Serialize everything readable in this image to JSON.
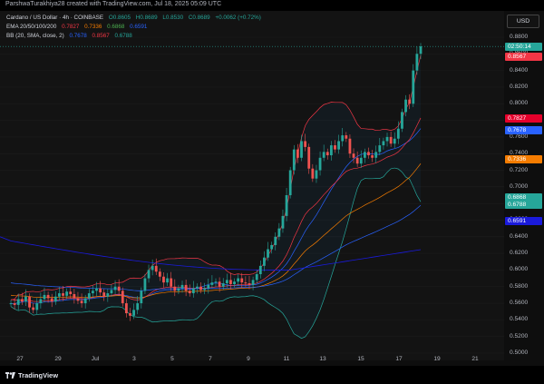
{
  "header": {
    "created_by": "ParshwaTurakhiya28 created with TradingView.com, Jul 18, 2025 05:09 UTC"
  },
  "legend": {
    "symbol_line": {
      "name": "Cardano / US Dollar · 4h · COINBASE",
      "o": "O0.8605",
      "h": "H0.8689",
      "l": "L0.8530",
      "c": "C0.8689",
      "change": "+0.0062 (+0.72%)"
    },
    "ema_line": {
      "name": "EMA 20/50/100/200",
      "v1": "0.7827",
      "v2": "0.7336",
      "v3": "0.6868",
      "v4": "0.6591"
    },
    "bb_line": {
      "name": "BB (20, SMA, close, 2)",
      "v1": "0.7678",
      "v2": "0.8567",
      "v3": "0.6788"
    }
  },
  "currency_button": "USD",
  "price_axis": {
    "ticks": [
      "0.8800",
      "0.8600",
      "0.8400",
      "0.8200",
      "0.8000",
      "0.7800",
      "0.7600",
      "0.7400",
      "0.7200",
      "0.7000",
      "0.6800",
      "0.6600",
      "0.6400",
      "0.6200",
      "0.6000",
      "0.5800",
      "0.5600",
      "0.5400",
      "0.5200",
      "0.5000"
    ],
    "tags": [
      {
        "label": "02:50:14",
        "price": 0.8689,
        "color": "#26a69a"
      },
      {
        "label": "0.8567",
        "price": 0.8567,
        "color": "#f23645"
      },
      {
        "label": "0.7827",
        "price": 0.7827,
        "color": "#e5002b"
      },
      {
        "label": "0.7678",
        "price": 0.7678,
        "color": "#2962ff"
      },
      {
        "label": "0.7336",
        "price": 0.7336,
        "color": "#f57c00"
      },
      {
        "label": "0.6868",
        "price": 0.6868,
        "color": "#26a69a"
      },
      {
        "label": "0.6788",
        "price": 0.6788,
        "color": "#26a69a"
      },
      {
        "label": "0.6591",
        "price": 0.6591,
        "color": "#1a1adb"
      }
    ]
  },
  "time_axis": {
    "ticks": [
      "27",
      "29",
      "Jul",
      "3",
      "5",
      "7",
      "9",
      "11",
      "13",
      "15",
      "17",
      "19",
      "21"
    ]
  },
  "footer": {
    "brand": "TradingView"
  },
  "colors": {
    "up": "#26a69a",
    "down": "#ef5350",
    "ema20": "#f23645",
    "ema50": "#f57c00",
    "ema100": "#2962ff",
    "ema200": "#1a1adb",
    "bb_basis": "#2962ff",
    "bb_band": "#f23645",
    "bb_lower": "#26a69a"
  },
  "chart_data": {
    "type": "candlestick",
    "title": "Cardano / US Dollar · 4h · COINBASE",
    "ylim": [
      0.5,
      0.88
    ],
    "x_labels": [
      "27",
      "29",
      "Jul",
      "3",
      "5",
      "7",
      "9",
      "11",
      "13",
      "15",
      "17",
      "19",
      "21"
    ],
    "candles_close_approx": [
      0.56,
      0.558,
      0.565,
      0.562,
      0.568,
      0.555,
      0.552,
      0.56,
      0.565,
      0.57,
      0.566,
      0.562,
      0.568,
      0.572,
      0.569,
      0.574,
      0.571,
      0.566,
      0.563,
      0.56,
      0.566,
      0.572,
      0.575,
      0.578,
      0.573,
      0.568,
      0.572,
      0.576,
      0.58,
      0.575,
      0.56,
      0.548,
      0.545,
      0.552,
      0.56,
      0.575,
      0.59,
      0.6,
      0.605,
      0.598,
      0.592,
      0.585,
      0.59,
      0.58,
      0.575,
      0.578,
      0.582,
      0.575,
      0.572,
      0.578,
      0.58,
      0.576,
      0.578,
      0.582,
      0.585,
      0.586,
      0.58,
      0.584,
      0.588,
      0.583,
      0.586,
      0.59,
      0.585,
      0.584,
      0.582,
      0.588,
      0.595,
      0.605,
      0.615,
      0.625,
      0.63,
      0.64,
      0.65,
      0.665,
      0.69,
      0.72,
      0.745,
      0.735,
      0.755,
      0.748,
      0.722,
      0.71,
      0.72,
      0.735,
      0.742,
      0.738,
      0.75,
      0.745,
      0.755,
      0.762,
      0.758,
      0.74,
      0.735,
      0.728,
      0.735,
      0.742,
      0.738,
      0.735,
      0.742,
      0.75,
      0.755,
      0.76,
      0.752,
      0.758,
      0.77,
      0.79,
      0.805,
      0.8,
      0.84,
      0.86,
      0.869
    ],
    "ema20_last": 0.7827,
    "ema50_last": 0.7336,
    "ema100_last": 0.6868,
    "ema200_last": 0.6591,
    "bb_basis_last": 0.7678,
    "bb_upper_last": 0.8567,
    "bb_lower_last": 0.6788
  }
}
